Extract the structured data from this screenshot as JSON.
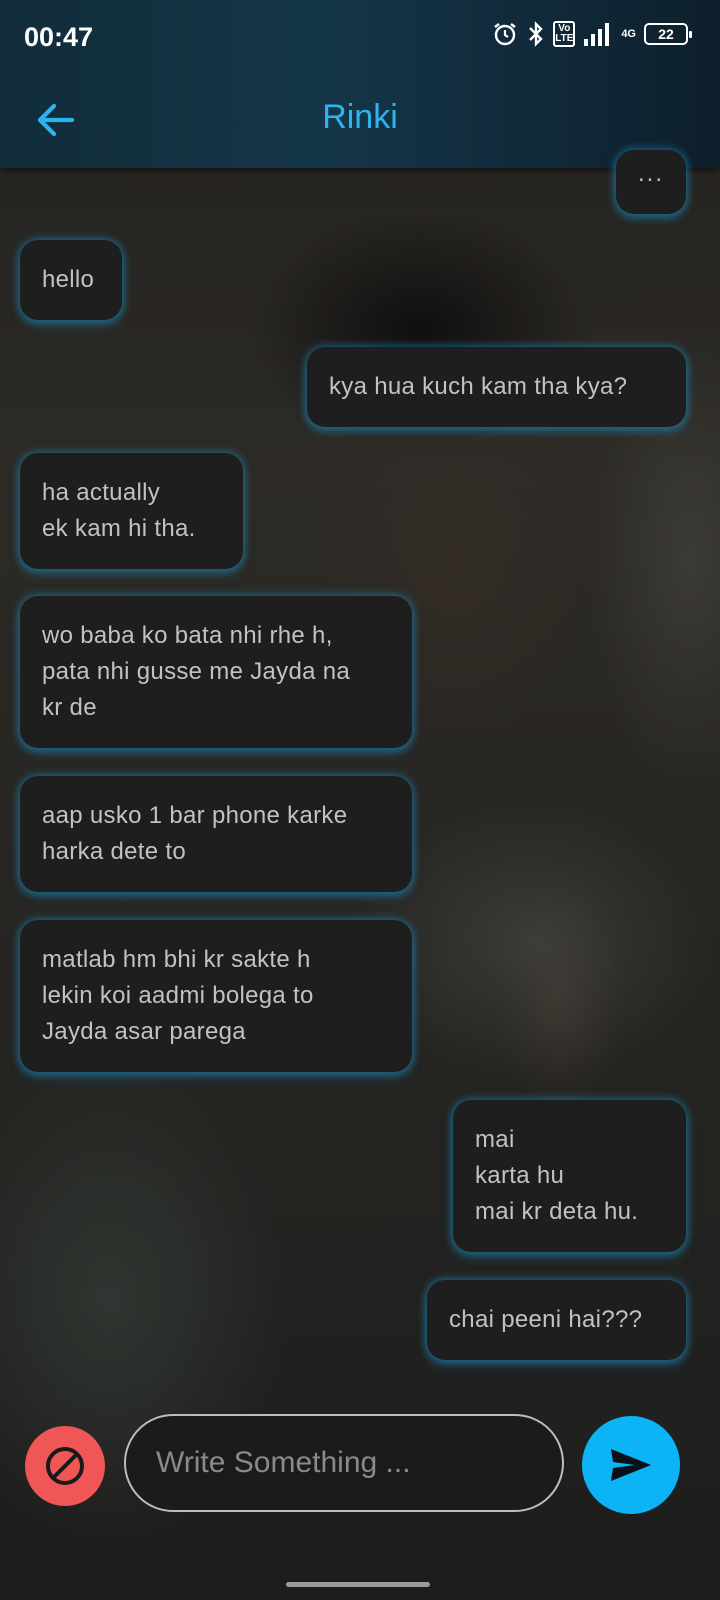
{
  "status_bar": {
    "time": "00:47",
    "volte": "Vo\nLTE",
    "network": "4G",
    "battery": "22"
  },
  "header": {
    "title": "Rinki",
    "accent_color": "#2db4ef"
  },
  "messages": [
    {
      "side": "sent",
      "text": "..."
    },
    {
      "side": "received",
      "text": "hello"
    },
    {
      "side": "sent",
      "text": "kya hua kuch kam tha kya?"
    },
    {
      "side": "received",
      "text": "ha actually\nek kam hi tha."
    },
    {
      "side": "received",
      "text": "wo baba ko bata nhi rhe h,\npata nhi gusse me Jayda na\nkr de"
    },
    {
      "side": "received",
      "text": "aap usko 1 bar phone karke\nharka dete to"
    },
    {
      "side": "received",
      "text": "matlab hm bhi kr sakte h\nlekin koi aadmi bolega to\nJayda asar parega"
    },
    {
      "side": "sent",
      "text": "mai\nkarta hu\nmai kr deta hu."
    },
    {
      "side": "sent",
      "text": "chai peeni hai???"
    }
  ],
  "composer": {
    "placeholder": "Write Something ...",
    "value": "",
    "block_color": "#f05656",
    "send_color": "#0cb4f5"
  }
}
